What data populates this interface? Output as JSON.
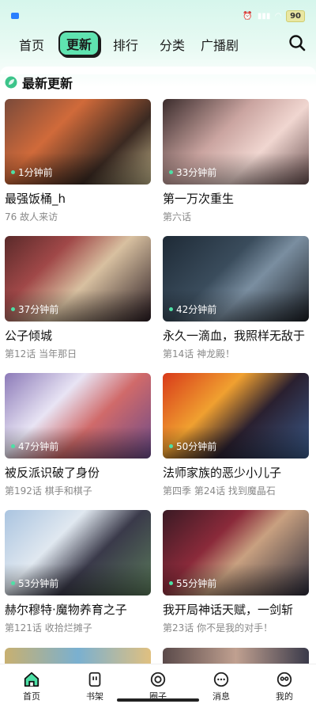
{
  "status_bar": {
    "time": "",
    "battery": "90"
  },
  "top_nav": {
    "tabs": [
      {
        "label": "首页",
        "active": false
      },
      {
        "label": "更新",
        "active": true
      },
      {
        "label": "排行",
        "active": false
      },
      {
        "label": "分类",
        "active": false
      },
      {
        "label": "广播剧",
        "active": false
      }
    ],
    "search_icon": "search-icon"
  },
  "section": {
    "title": "最新更新",
    "icon": "leaf-icon",
    "accent": "#3cc48a"
  },
  "comics": [
    {
      "title": "最强饭桶_h",
      "subtitle": "76 故人来访",
      "time": "1分钟前"
    },
    {
      "title": "第一万次重生",
      "subtitle": "第六话",
      "time": "33分钟前"
    },
    {
      "title": "公子倾城",
      "subtitle": "第12话 当年那日",
      "time": "37分钟前"
    },
    {
      "title": "永久一滴血，我照样无敌于",
      "subtitle": "第14话 神龙殿！",
      "time": "42分钟前"
    },
    {
      "title": "被反派识破了身份",
      "subtitle": "第192话 棋手和棋子",
      "time": "47分钟前"
    },
    {
      "title": "法师家族的恶少小儿子",
      "subtitle": "第四季 第24话 找到魔晶石",
      "time": "50分钟前"
    },
    {
      "title": "赫尔穆特·魔物养育之子",
      "subtitle": "第121话 收拾烂摊子",
      "time": "53分钟前"
    },
    {
      "title": "我开局神话天赋，一剑斩",
      "subtitle": "第23话 你不是我的对手！",
      "time": "55分钟前"
    }
  ],
  "bottom_nav": [
    {
      "label": "首页",
      "icon": "home-icon",
      "active": true
    },
    {
      "label": "书架",
      "icon": "bookshelf-icon",
      "active": false
    },
    {
      "label": "圈子",
      "icon": "circle-icon",
      "active": false
    },
    {
      "label": "消息",
      "icon": "message-icon",
      "active": false
    },
    {
      "label": "我的",
      "icon": "profile-icon",
      "active": false
    }
  ]
}
